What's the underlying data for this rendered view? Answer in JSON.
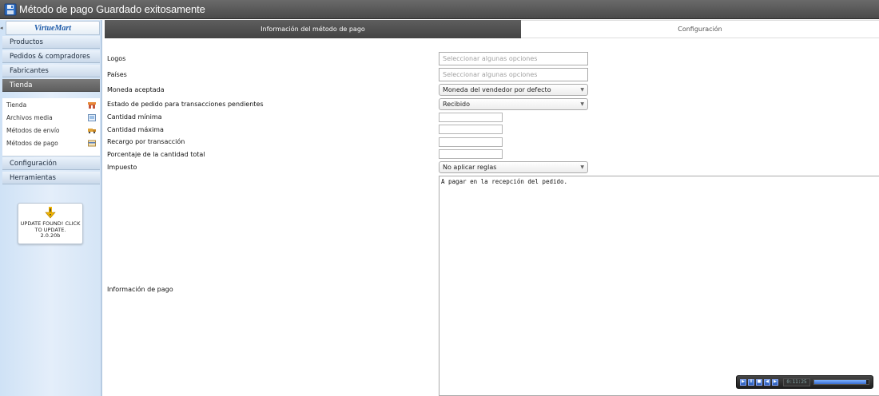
{
  "window": {
    "title": "Método de pago Guardado exitosamente"
  },
  "sidebar": {
    "logo": "VirtueMart",
    "menu": [
      {
        "label": "Productos",
        "active": false
      },
      {
        "label": "Pedidos & compradores",
        "active": false
      },
      {
        "label": "Fabricantes",
        "active": false
      },
      {
        "label": "Tienda",
        "active": true
      }
    ],
    "submenu": [
      {
        "label": "Tienda",
        "icon": "store-icon"
      },
      {
        "label": "Archivos media",
        "icon": "media-icon"
      },
      {
        "label": "Métodos de envío",
        "icon": "truck-icon"
      },
      {
        "label": "Métodos de pago",
        "icon": "payment-icon"
      }
    ],
    "menu_bottom": [
      {
        "label": "Configuración"
      },
      {
        "label": "Herramientas"
      }
    ],
    "update": {
      "line1": "UPDATE FOUND! CLICK TO UPDATE.",
      "version": "2.0.20b"
    }
  },
  "tabs": [
    {
      "label": "Información del método de pago",
      "active": true
    },
    {
      "label": "Configuración",
      "active": false
    }
  ],
  "form": {
    "logos": {
      "label": "Logos",
      "placeholder": "Seleccionar algunas opciones"
    },
    "paises": {
      "label": "Países",
      "placeholder": "Seleccionar algunas opciones"
    },
    "moneda": {
      "label": "Moneda aceptada",
      "value": "Moneda del vendedor por defecto"
    },
    "estado": {
      "label": "Estado de pedido para transacciones pendientes",
      "value": "Recibido"
    },
    "cantidad_minima": {
      "label": "Cantidad mínima",
      "value": ""
    },
    "cantidad_maxima": {
      "label": "Cantidad máxima",
      "value": ""
    },
    "recargo": {
      "label": "Recargo por transacción",
      "value": ""
    },
    "porcentaje": {
      "label": "Porcentaje de la cantidad total",
      "value": ""
    },
    "impuesto": {
      "label": "Impuesto",
      "value": "No aplicar reglas"
    },
    "info_pago": {
      "label": "Información de pago",
      "value": "A pagar en la recepción del pedido."
    }
  },
  "player": {
    "time": "0:11:25",
    "progress": 0.95
  },
  "colors": {
    "tab_active": "#4f4f4f",
    "menu_active": "#6b6b6b",
    "sidebar_bg": "#dce9f7",
    "accent": "#1e5aa8"
  }
}
